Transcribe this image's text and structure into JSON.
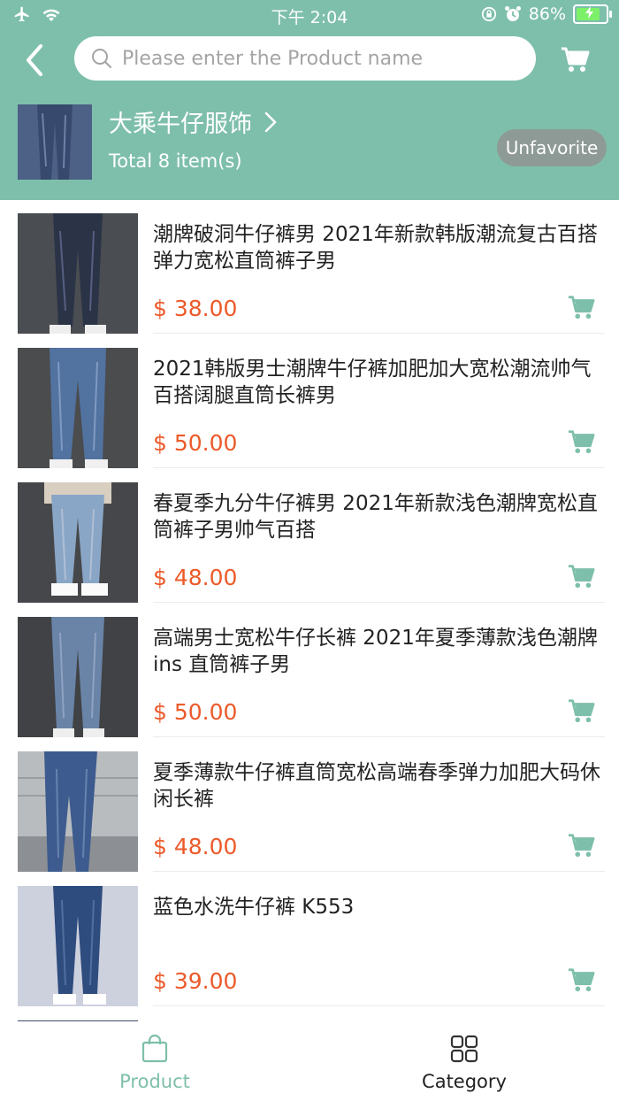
{
  "status_bar": {
    "time": "下午 2:04",
    "battery": "86%"
  },
  "search": {
    "placeholder": "Please enter the Product name"
  },
  "shop": {
    "name": "大乘牛仔服饰",
    "total": "Total 8 item(s)",
    "unfavorite_label": "Unfavorite"
  },
  "products": [
    {
      "title": "潮牌破洞牛仔裤男 2021年新款韩版潮流复古百搭弹力宽松直筒裤子男",
      "price": "$ 38.00"
    },
    {
      "title": "2021韩版男士潮牌牛仔裤加肥加大宽松潮流帅气百搭阔腿直筒长裤男",
      "price": "$ 50.00"
    },
    {
      "title": "春夏季九分牛仔裤男 2021年新款浅色潮牌宽松直筒裤子男帅气百搭",
      "price": "$ 48.00"
    },
    {
      "title": "高端男士宽松牛仔长裤 2021年夏季薄款浅色潮牌 ins 直筒裤子男",
      "price": "$ 50.00"
    },
    {
      "title": "夏季薄款牛仔裤直筒宽松高端春季弹力加肥大码休闲长裤",
      "price": "$ 48.00"
    },
    {
      "title": "蓝色水洗牛仔裤 K553",
      "price": "$ 39.00"
    }
  ],
  "tabs": [
    {
      "label": "Product",
      "icon": "shopping-bag-icon",
      "active": true
    },
    {
      "label": "Category",
      "icon": "grid-icon",
      "active": false
    }
  ],
  "colors": {
    "header": "#7ebfab",
    "accent": "#7ebfab",
    "price": "#ec5a2a",
    "unfavorite_bg": "#8e9a96"
  }
}
